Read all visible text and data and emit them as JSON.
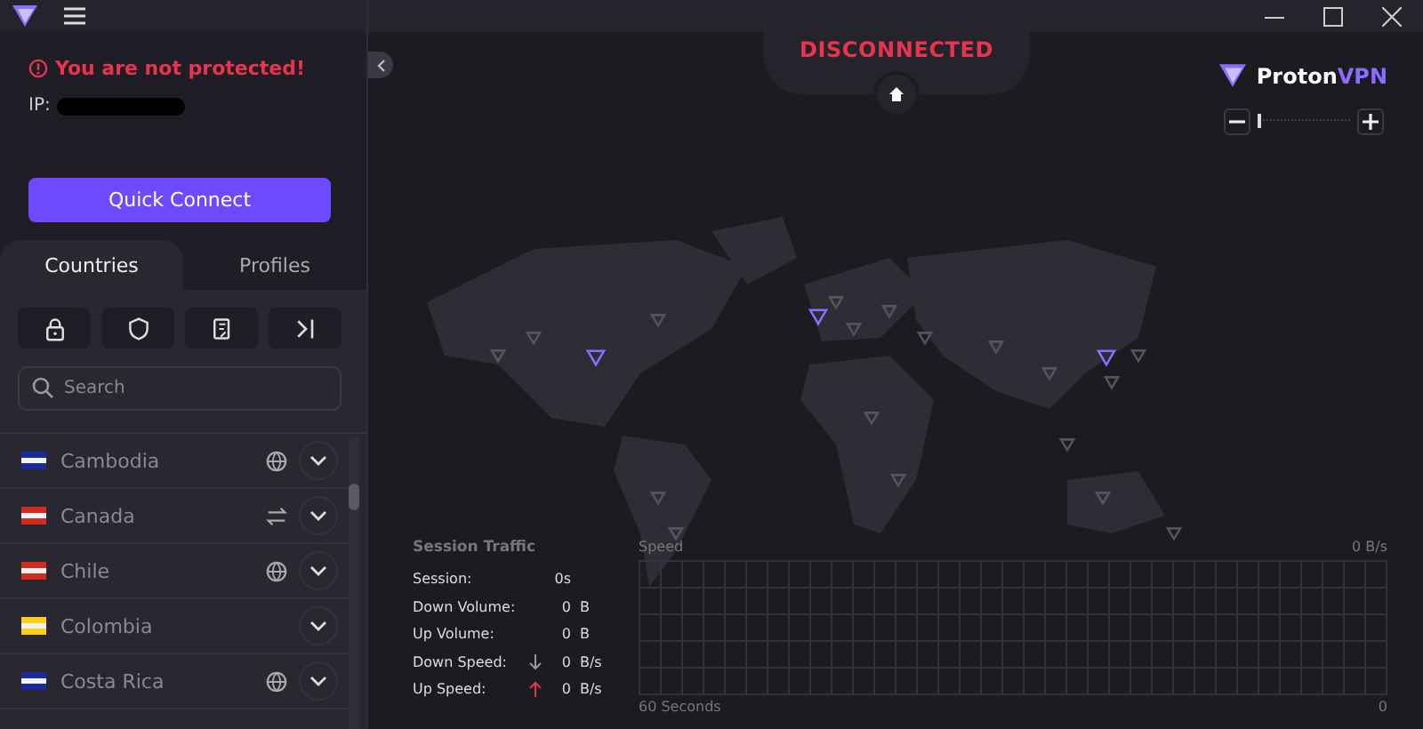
{
  "status": {
    "warning": "You are not protected!",
    "ip_label": "IP:"
  },
  "quick_connect": "Quick Connect",
  "tabs": [
    {
      "label": "Countries",
      "selected": true
    },
    {
      "label": "Profiles",
      "selected": false
    }
  ],
  "filters": [
    {
      "kind": "lock"
    },
    {
      "kind": "shield"
    },
    {
      "kind": "card"
    },
    {
      "kind": "skip"
    }
  ],
  "search": {
    "placeholder": "Search"
  },
  "countries": [
    {
      "name": "Cambodia",
      "color": "#1a2a9c",
      "kind": "globe"
    },
    {
      "name": "Canada",
      "color": "#d52b1e",
      "kind": "p2p"
    },
    {
      "name": "Chile",
      "color": "#d52b1e",
      "kind": "globe"
    },
    {
      "name": "Colombia",
      "color": "#fcd116",
      "kind": "plain"
    },
    {
      "name": "Costa Rica",
      "color": "#1a2a9c",
      "kind": "globe"
    }
  ],
  "map": {
    "state": "DISCONNECTED",
    "logo": {
      "name": "Proton",
      "suffix": "VPN"
    },
    "zoom": {
      "level": 0
    }
  },
  "traffic": {
    "title": "Session Traffic",
    "rows": [
      {
        "label": "Session:",
        "value": "0s",
        "unit": "",
        "kind": "none"
      },
      {
        "label": "Down Volume:",
        "value": "0",
        "unit": "B",
        "kind": "none"
      },
      {
        "label": "Up Volume:",
        "value": "0",
        "unit": "B",
        "kind": "none"
      },
      {
        "label": "Down Speed:",
        "value": "0",
        "unit": "B/s",
        "kind": "down"
      },
      {
        "label": "Up Speed:",
        "value": "0",
        "unit": "B/s",
        "kind": "up"
      }
    ],
    "graph": {
      "title": "Speed",
      "max": "0 B/s",
      "span": "60 Seconds",
      "origin": "0"
    }
  }
}
